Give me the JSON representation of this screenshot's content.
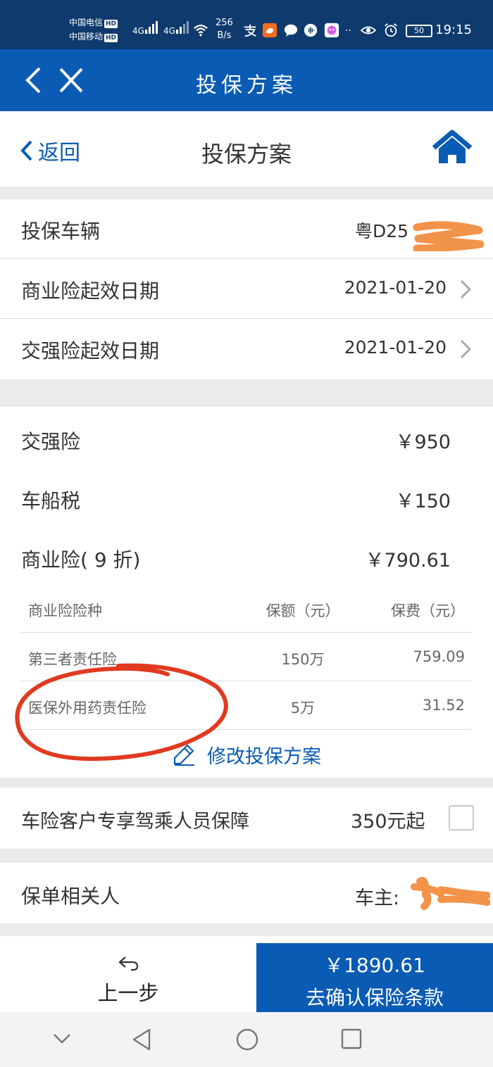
{
  "status_bar": {
    "carrier1": "中国电信",
    "carrier2": "中国移动",
    "hd_badge": "HD",
    "net1": "4G",
    "net2": "4G",
    "speed_value": "256",
    "speed_unit": "B/s",
    "battery": "50",
    "time": "19:15"
  },
  "app_header": {
    "title": "投保方案"
  },
  "nav": {
    "back_label": "返回",
    "title": "投保方案"
  },
  "vehicle": {
    "vehicle_label": "投保车辆",
    "vehicle_value": "粤D25",
    "commercial_date_label": "商业险起效日期",
    "commercial_date_value": "2021-01-20",
    "compulsory_date_label": "交强险起效日期",
    "compulsory_date_value": "2021-01-20"
  },
  "fees": {
    "compulsory_label": "交强险",
    "compulsory_value": "￥950",
    "tax_label": "车船税",
    "tax_value": "￥150",
    "commercial_label": "商业险( 9 折)",
    "commercial_value": "￥790.61"
  },
  "coverage_table": {
    "headers": [
      "商业险险种",
      "保额（元）",
      "保费（元）"
    ],
    "rows": [
      [
        "第三者责任险",
        "150万",
        "759.09"
      ],
      [
        "医保外用药责任险",
        "5万",
        "31.52"
      ]
    ]
  },
  "edit_plan_label": "修改投保方案",
  "addon": {
    "label": "车险客户专享驾乘人员保障",
    "price": "350元起",
    "checked": false
  },
  "policy_party": {
    "label": "保单相关人",
    "value": "车主:"
  },
  "bottom": {
    "prev_label": "上一步",
    "total": "￥1890.61",
    "confirm_label": "去确认保险条款"
  },
  "colors": {
    "primary": "#0a5bb4",
    "status_bar": "#0f3a6e",
    "annotation": "#e03a20",
    "redaction": "#f2934a"
  }
}
